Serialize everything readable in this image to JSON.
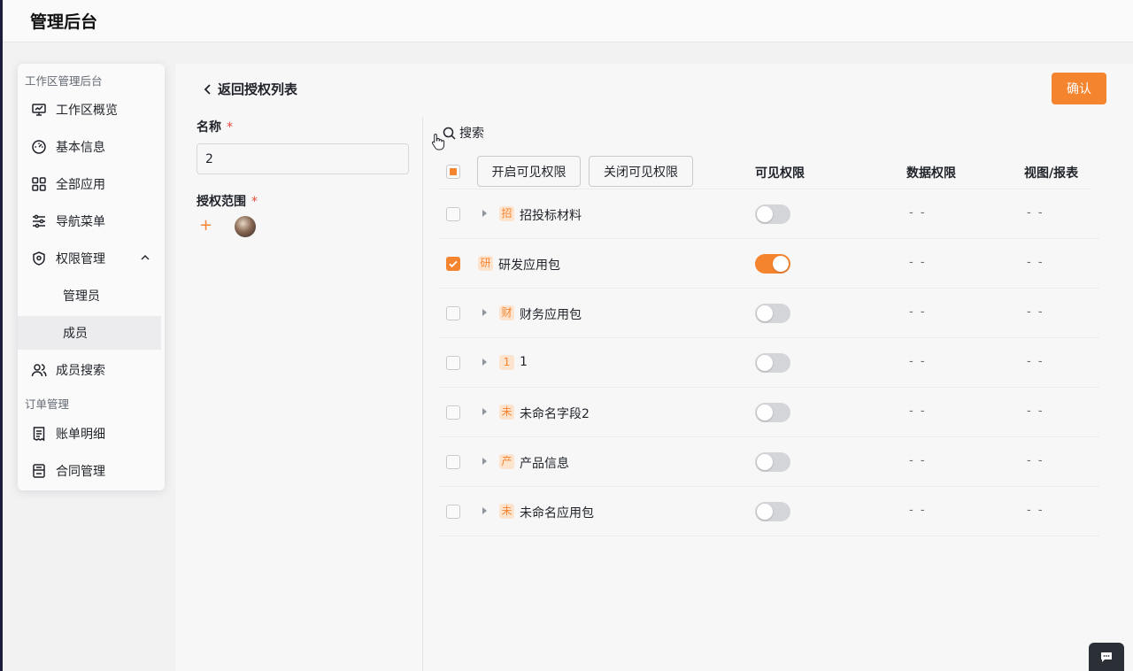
{
  "app": {
    "title": "管理后台"
  },
  "sidebar": {
    "section1": "工作区管理后台",
    "items": [
      {
        "label": "工作区概览",
        "icon": "monitor-icon"
      },
      {
        "label": "基本信息",
        "icon": "dashboard-gauge-icon"
      },
      {
        "label": "全部应用",
        "icon": "grid-icon"
      },
      {
        "label": "导航菜单",
        "icon": "sliders-icon"
      },
      {
        "label": "权限管理",
        "icon": "shield-icon"
      }
    ],
    "sub_items": [
      {
        "label": "管理员"
      },
      {
        "label": "成员"
      }
    ],
    "member_search": {
      "label": "成员搜索",
      "icon": "users-icon"
    },
    "section2": "订单管理",
    "items2": [
      {
        "label": "账单明细",
        "icon": "receipt-icon"
      },
      {
        "label": "合同管理",
        "icon": "contract-icon"
      }
    ]
  },
  "page": {
    "back_label": "返回授权列表",
    "confirm_label": "确认",
    "name_label": "名称",
    "name_value": "2",
    "scope_label": "授权范围",
    "required_mark": "*",
    "add_symbol": "+"
  },
  "table": {
    "search_label": "搜索",
    "enable_button": "开启可见权限",
    "disable_button": "关闭可见权限",
    "columns": [
      "可见权限",
      "数据权限",
      "视图/报表"
    ],
    "rows": [
      {
        "badge": "招",
        "name": "招投标材料",
        "expandable": true,
        "checked": false,
        "visible": false,
        "data": "- -",
        "view": "- -"
      },
      {
        "badge": "研",
        "name": "研发应用包",
        "expandable": false,
        "checked": true,
        "visible": true,
        "data": "- -",
        "view": "- -"
      },
      {
        "badge": "财",
        "name": "财务应用包",
        "expandable": true,
        "checked": false,
        "visible": false,
        "data": "- -",
        "view": "- -"
      },
      {
        "badge": "1",
        "name": "1",
        "expandable": true,
        "checked": false,
        "visible": false,
        "data": "- -",
        "view": "- -"
      },
      {
        "badge": "未",
        "name": "未命名字段2",
        "expandable": true,
        "checked": false,
        "visible": false,
        "data": "- -",
        "view": "- -"
      },
      {
        "badge": "产",
        "name": "产品信息",
        "expandable": true,
        "checked": false,
        "visible": false,
        "data": "- -",
        "view": "- -"
      },
      {
        "badge": "未",
        "name": "未命名应用包",
        "expandable": true,
        "checked": false,
        "visible": false,
        "data": "- -",
        "view": "- -"
      }
    ]
  },
  "colors": {
    "accent": "#f5842f",
    "badge_bg": "#fde4cf",
    "toggle_off": "#d3d5d9"
  }
}
